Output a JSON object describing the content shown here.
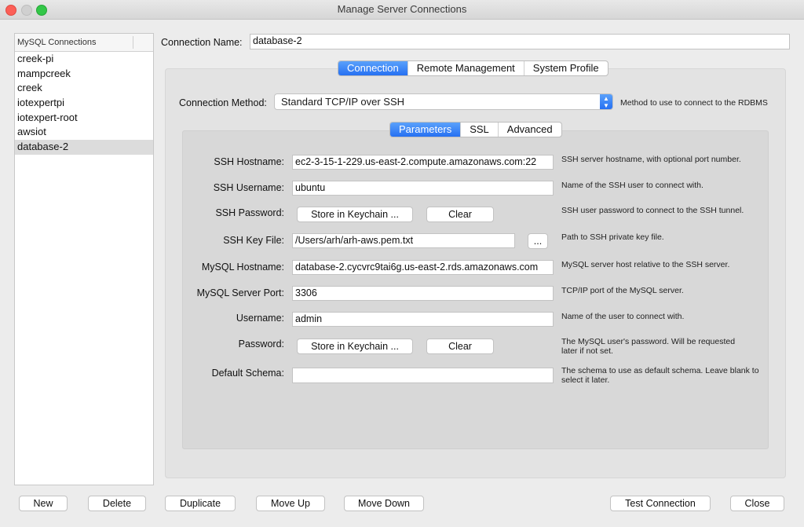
{
  "window": {
    "title": "Manage Server Connections"
  },
  "sidebar": {
    "header": "MySQL Connections",
    "items": [
      "creek-pi",
      "mampcreek",
      "creek",
      "iotexpertpi",
      "iotexpert-root",
      "awsiot",
      "database-2"
    ],
    "selected": "database-2"
  },
  "connection_name": {
    "label": "Connection Name:",
    "value": "database-2"
  },
  "main_tabs": [
    "Connection",
    "Remote Management",
    "System Profile"
  ],
  "main_tab_active": "Connection",
  "method": {
    "label": "Connection Method:",
    "value": "Standard TCP/IP over SSH",
    "help": "Method to use to connect to the RDBMS"
  },
  "sub_tabs": [
    "Parameters",
    "SSL",
    "Advanced"
  ],
  "sub_tab_active": "Parameters",
  "fields": {
    "ssh_hostname": {
      "label": "SSH Hostname:",
      "value": "ec2-3-15-1-229.us-east-2.compute.amazonaws.com:22",
      "help": "SSH server hostname, with  optional port number."
    },
    "ssh_username": {
      "label": "SSH Username:",
      "value": "ubuntu",
      "help": "Name of the SSH user to connect with."
    },
    "ssh_password": {
      "label": "SSH Password:",
      "store": "Store in Keychain ...",
      "clear": "Clear",
      "help": "SSH user password to connect to the SSH tunnel."
    },
    "ssh_keyfile": {
      "label": "SSH Key File:",
      "value": "/Users/arh/arh-aws.pem.txt",
      "browse": "...",
      "help": "Path to SSH private key file."
    },
    "mysql_hostname": {
      "label": "MySQL Hostname:",
      "value": "database-2.cycvrc9tai6g.us-east-2.rds.amazonaws.com",
      "help": "MySQL server host relative to the SSH server."
    },
    "mysql_port": {
      "label": "MySQL Server Port:",
      "value": "3306",
      "help": "TCP/IP port of the MySQL server."
    },
    "username": {
      "label": "Username:",
      "value": "admin",
      "help": "Name of the user to connect with."
    },
    "password": {
      "label": "Password:",
      "store": "Store in Keychain ...",
      "clear": "Clear",
      "help": "The MySQL user's password. Will be requested later if not set."
    },
    "default_schema": {
      "label": "Default Schema:",
      "value": "",
      "help": "The schema to use as default schema. Leave blank to select it later."
    }
  },
  "bottom_buttons": {
    "new": "New",
    "delete": "Delete",
    "duplicate": "Duplicate",
    "move_up": "Move Up",
    "move_down": "Move Down",
    "test": "Test Connection",
    "close": "Close"
  }
}
